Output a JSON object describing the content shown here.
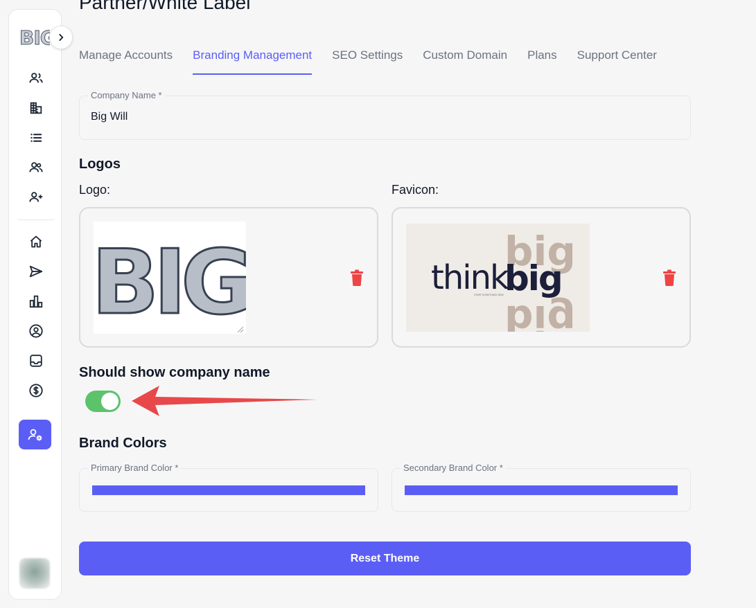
{
  "sidebar": {
    "logo_text": "BIG",
    "icons": [
      "users-icon",
      "building-icon",
      "list-icon",
      "team-icon",
      "add-user-icon",
      "home-icon",
      "send-icon",
      "chart-icon",
      "user-circle-icon",
      "inbox-icon",
      "dollar-icon",
      "user-settings-icon"
    ]
  },
  "header": {
    "title": "Partner/White Label",
    "tabs": [
      {
        "label": "Manage Accounts"
      },
      {
        "label": "Branding Management",
        "active": true
      },
      {
        "label": "SEO Settings"
      },
      {
        "label": "Custom Domain"
      },
      {
        "label": "Plans"
      },
      {
        "label": "Support Center"
      }
    ]
  },
  "company": {
    "label": "Company Name *",
    "value": "Big Will"
  },
  "logos": {
    "title": "Logos",
    "logo_label": "Logo:",
    "favicon_label": "Favicon:",
    "logo_image_text": "BIG",
    "favicon_text_light": "think",
    "favicon_text_bold": "big",
    "favicon_tagline": "START SOMETHING NEW"
  },
  "toggle": {
    "label": "Should show company name",
    "checked": true
  },
  "brand_colors": {
    "title": "Brand Colors",
    "primary_label": "Primary Brand Color *",
    "primary_value": "#5b5ef5",
    "secondary_label": "Secondary Brand Color *",
    "secondary_value": "#5b5ef5"
  },
  "reset_button": "Reset Theme",
  "colors": {
    "accent": "#5b5ef5",
    "toggle_on": "#5cc36a",
    "danger": "#ef4444",
    "annotation_arrow": "#e8484a"
  }
}
